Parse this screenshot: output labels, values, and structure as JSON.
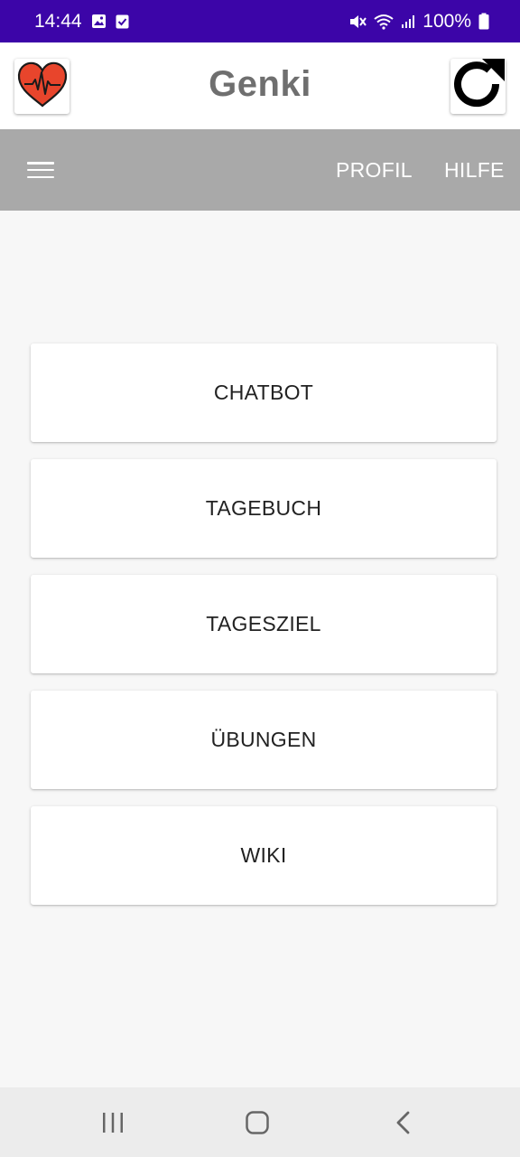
{
  "status_bar": {
    "time": "14:44",
    "battery": "100%",
    "left_icons": [
      "image-icon",
      "checkbox-icon"
    ],
    "right_icons": [
      "mute-icon",
      "wifi-icon",
      "signal-icon",
      "battery-icon"
    ]
  },
  "header": {
    "title": "Genki",
    "logo_icon": "heart-pulse-icon",
    "refresh_icon": "refresh-icon"
  },
  "toolbar": {
    "menu_icon": "hamburger-menu-icon",
    "links": [
      {
        "label": "PROFIL"
      },
      {
        "label": "HILFE"
      }
    ]
  },
  "main_buttons": [
    {
      "label": "CHATBOT"
    },
    {
      "label": "TAGEBUCH"
    },
    {
      "label": "TAGESZIEL"
    },
    {
      "label": "ÜBUNGEN"
    },
    {
      "label": "WIKI"
    }
  ],
  "nav_bar": {
    "buttons": [
      "recent-apps-icon",
      "home-icon",
      "back-icon"
    ]
  },
  "colors": {
    "status_bar": "#3c05a8",
    "toolbar": "#a9a9a9",
    "title": "#6f6f6f",
    "heart": "#e8452c",
    "background": "#f7f7f7"
  }
}
